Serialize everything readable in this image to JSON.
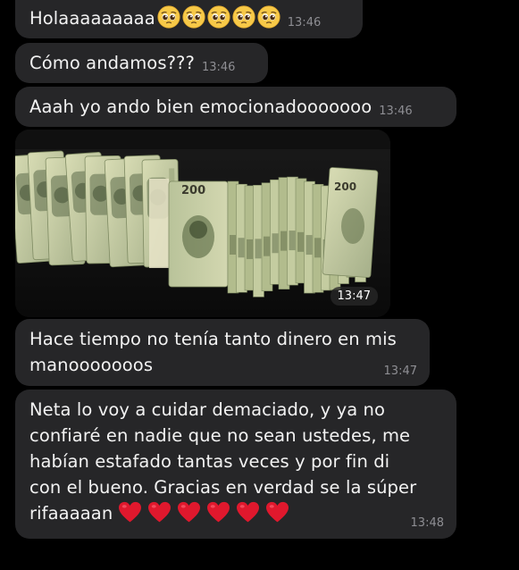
{
  "messages": [
    {
      "text": "Holaaaaaaaaa",
      "emoji": "pleading-face-icon",
      "emoji_count": 5,
      "time": "13:46"
    },
    {
      "text": "Cómo andamos???",
      "time": "13:46"
    },
    {
      "text": "Aaah yo ando bien emocionadooooooo",
      "time": "13:46"
    },
    {
      "type": "image",
      "image_description": "billetes-icon",
      "time": "13:47",
      "banknote_value": "200"
    },
    {
      "lines": [
        "Hace tiempo no tenía tanto dinero en mis",
        "manooooooos"
      ],
      "time": "13:47"
    },
    {
      "lines": [
        "Neta lo voy a cuidar demaciado, y ya no",
        "confiaré en nadie que no sean ustedes, me",
        "habían estafado tantas veces y por fin di",
        "con el bueno. Gracias en verdad se la súper",
        "rifaaaaan"
      ],
      "hearts": "red-heart-icon",
      "heart_count": 6,
      "time": "13:48"
    }
  ],
  "colors": {
    "background": "#000000",
    "bubble": "#262628",
    "timestamp": "#8e8e93",
    "heart": "#e0182d",
    "banknote": "#c9cfa4"
  }
}
